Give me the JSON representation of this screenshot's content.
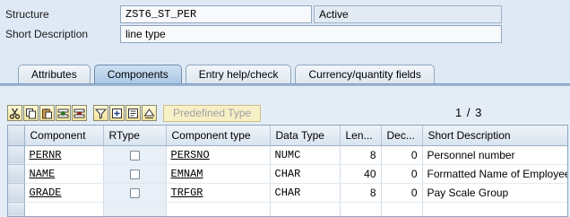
{
  "header": {
    "structure_label": "Structure",
    "structure_value": "ZST6_ST_PER",
    "status": "Active",
    "short_desc_label": "Short Description",
    "short_desc_value": "line type"
  },
  "tabs": [
    {
      "label": "Attributes",
      "active": false
    },
    {
      "label": "Components",
      "active": true
    },
    {
      "label": "Entry help/check",
      "active": false
    },
    {
      "label": "Currency/quantity fields",
      "active": false
    }
  ],
  "toolbar": {
    "icons": [
      "cut-icon",
      "copy-icon",
      "paste-icon",
      "insert-row-icon",
      "delete-row-icon",
      "filter-icon",
      "insert-icon",
      "details-icon",
      "up-icon"
    ],
    "predefined_type_label": "Predefined Type"
  },
  "pager": "1 / 3",
  "grid": {
    "columns": [
      "Component",
      "RType",
      "Component type",
      "Data Type",
      "Len...",
      "Dec...",
      "Short Description"
    ],
    "rows": [
      {
        "component": "PERNR",
        "rtype": false,
        "component_type": "PERSNO",
        "data_type": "NUMC",
        "length": "8",
        "decimals": "0",
        "short_desc": "Personnel number"
      },
      {
        "component": "NAME",
        "rtype": false,
        "component_type": "EMNAM",
        "data_type": "CHAR",
        "length": "40",
        "decimals": "0",
        "short_desc": "Formatted Name of Employee"
      },
      {
        "component": "GRADE",
        "rtype": false,
        "component_type": "TRFGR",
        "data_type": "CHAR",
        "length": "8",
        "decimals": "0",
        "short_desc": "Pay Scale Group"
      }
    ]
  },
  "colors": {
    "background": "#dfe9f5",
    "active_tab": "#a9c7e6",
    "toolbar_button": "#f1e39c"
  }
}
